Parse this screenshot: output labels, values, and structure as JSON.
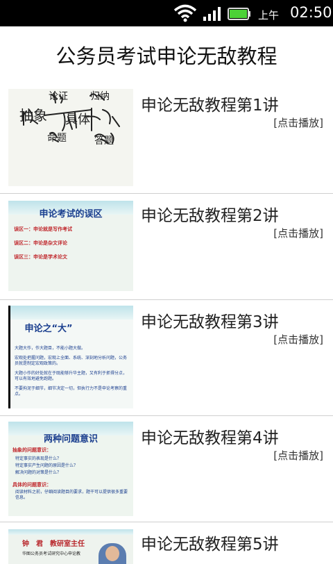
{
  "status_bar": {
    "ampm": "上午",
    "time": "02:50",
    "battery_color": "#4cd137"
  },
  "header": {
    "title": "公务员考试申论无敌教程"
  },
  "items": [
    {
      "label": "申论无敌教程第1讲",
      "action": "[点击播放]",
      "thumb_words": [
        "抽象",
        "具体",
        "论证",
        "归纳",
        "命题",
        "答题"
      ]
    },
    {
      "label": "申论无敌教程第2讲",
      "action": "[点击播放]",
      "slide_title": "申论考试的误区",
      "slide_lines": [
        "误区一：申论就是写作考试",
        "误区二：申论是杂文评论",
        "误区三：申论是学术论文"
      ]
    },
    {
      "label": "申论无敌教程第3讲",
      "action": "[点击播放]",
      "slide_title": "申论之“大”",
      "slide_lines": [
        "大题大作，作大题目，不能小题大做。",
        "宏观处把握问题，宏观上全面、系统、深刻地分析问题，公务员就是制定宏观政策的。",
        "大题小作的好处就在于既能够升华主题，又有利于抓得分点，可以有效地避免跑题。",
        "不要拘泥于细节，细节决定一切，但执行力不是申论考察的重点。"
      ]
    },
    {
      "label": "申论无敌教程第4讲",
      "action": "[点击播放]",
      "slide_title": "两种问题意识",
      "slide_lines": [
        "抽象的问题意识：",
        "特定事实的表现是什么？",
        "特定事实产生问题的原因是什么？",
        "解决问题的对策是什么？",
        "具体的问题意识：",
        "阅读材料之前，仔细阅读题目的要求，题干可以提供很多重要信息。"
      ]
    },
    {
      "label": "申论无敌教程第5讲",
      "action": "[点击播放]",
      "slide_title": "钟　君　教研室主任",
      "slide_lines": [
        "华图公务员考试研究中心申论教"
      ]
    }
  ]
}
